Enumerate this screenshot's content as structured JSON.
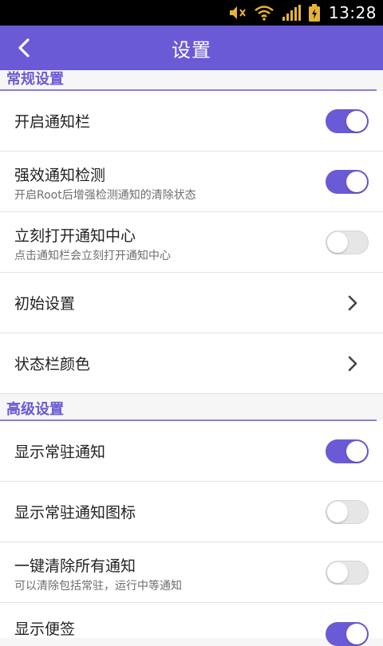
{
  "status_bar": {
    "time": "13:28",
    "icons": [
      "mute-icon",
      "wifi-icon",
      "signal-icon",
      "battery-icon"
    ]
  },
  "app_bar": {
    "title": "设置",
    "back_icon": "back-arrow-icon"
  },
  "sections": {
    "general": {
      "label": "常规设置",
      "items": [
        {
          "title": "开启通知栏",
          "type": "toggle",
          "on": true
        },
        {
          "title": "强效通知检测",
          "subtitle": "开启Root后增强检测通知的清除状态",
          "type": "toggle",
          "on": true
        },
        {
          "title": "立刻打开通知中心",
          "subtitle": "点击通知栏会立刻打开通知中心",
          "type": "toggle",
          "on": false
        },
        {
          "title": "初始设置",
          "type": "chevron"
        },
        {
          "title": "状态栏颜色",
          "type": "chevron"
        }
      ]
    },
    "advanced": {
      "label": "高级设置",
      "items": [
        {
          "title": "显示常驻通知",
          "type": "toggle",
          "on": true
        },
        {
          "title": "显示常驻通知图标",
          "type": "toggle",
          "on": false
        },
        {
          "title": "一键清除所有通知",
          "subtitle": "可以清除包括常驻，运行中等通知",
          "type": "toggle",
          "on": false
        },
        {
          "title": "显示便签",
          "type": "toggle",
          "on": true
        }
      ]
    }
  },
  "colors": {
    "accent": "#6a5ad6",
    "toggle_off": "#e6e6e6",
    "background": "#f6f6f6"
  }
}
